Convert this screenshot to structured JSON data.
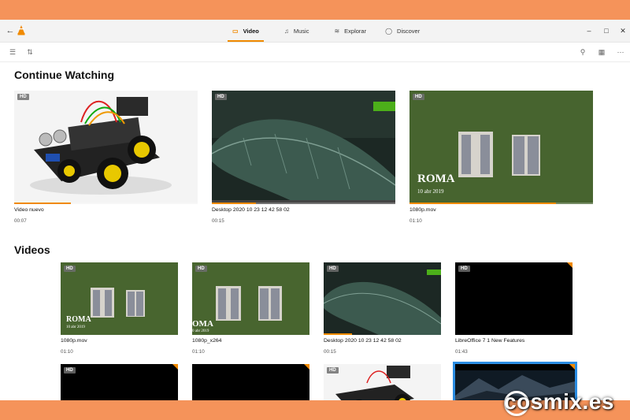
{
  "app": {
    "name": "VLC"
  },
  "tabs": [
    {
      "label": "Video",
      "icon": "video-icon",
      "active": true
    },
    {
      "label": "Music",
      "icon": "music-note-icon",
      "active": false
    },
    {
      "label": "Explorar",
      "icon": "network-icon",
      "active": false
    },
    {
      "label": "Discover",
      "icon": "compass-icon",
      "active": false
    }
  ],
  "continue_watching": {
    "title": "Continue Watching",
    "items": [
      {
        "name": "Video nuevo",
        "duration": "00:07",
        "progress": 0.31,
        "hd": "HD"
      },
      {
        "name": "Desktop 2020 10 23 12 42 58 02",
        "duration": "00:15",
        "progress": 0.24,
        "hd": "HD"
      },
      {
        "name": "1080p.mov",
        "duration": "01:10",
        "progress": 0.8,
        "hd": "HD",
        "overlay_title": "ROMA",
        "overlay_sub": "10 abr 2019"
      }
    ]
  },
  "videos": {
    "title": "Videos",
    "items": [
      {
        "name": "1080p.mov",
        "duration": "01:10",
        "hd": "HD",
        "overlay_title": "ROMA",
        "overlay_sub": "10 abr 2019"
      },
      {
        "name": "1080p_x264",
        "duration": "01:10",
        "hd": "HD",
        "overlay_title": "OMA",
        "overlay_sub": "0 abr 2019"
      },
      {
        "name": "Desktop 2020 10 23 12 42 58 02",
        "duration": "00:15",
        "hd": "HD",
        "progress": 0.24
      },
      {
        "name": "LibreOffice 7 1 New Features",
        "duration": "01:43",
        "hd": "HD"
      },
      {
        "hd": "HD"
      },
      {
        "hd": ""
      },
      {
        "hd": "HD"
      },
      {
        "hd": ""
      }
    ]
  },
  "watermark": "cosmix.es",
  "colors": {
    "accent": "#f08a00",
    "frame": "#f5935a",
    "selection": "#2b8de3"
  }
}
